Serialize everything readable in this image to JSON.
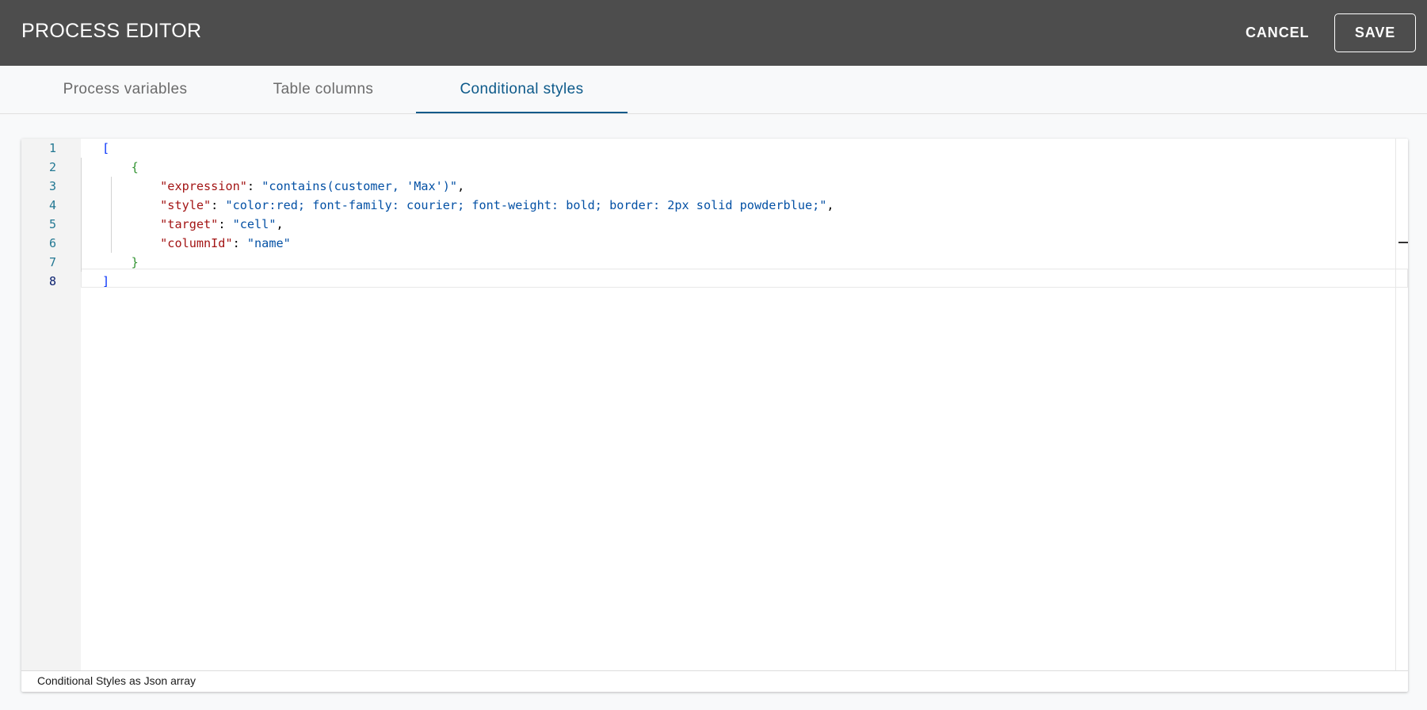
{
  "header": {
    "title": "PROCESS EDITOR",
    "cancel_label": "CANCEL",
    "save_label": "SAVE"
  },
  "tabs": [
    {
      "label": "Process variables",
      "active": false
    },
    {
      "label": "Table columns",
      "active": false
    },
    {
      "label": "Conditional styles",
      "active": true
    }
  ],
  "editor": {
    "line_numbers": [
      "1",
      "2",
      "3",
      "4",
      "5",
      "6",
      "7",
      "8"
    ],
    "current_line": "8",
    "lines": [
      {
        "indent": "",
        "tokens": [
          {
            "t": "b1",
            "v": "["
          }
        ]
      },
      {
        "indent": "    ",
        "tokens": [
          {
            "t": "b2",
            "v": "{"
          }
        ]
      },
      {
        "indent": "        ",
        "tokens": [
          {
            "t": "k",
            "v": "\"expression\""
          },
          {
            "t": "p",
            "v": ": "
          },
          {
            "t": "s",
            "v": "\"contains(customer, 'Max')\""
          },
          {
            "t": "p",
            "v": ","
          }
        ]
      },
      {
        "indent": "        ",
        "tokens": [
          {
            "t": "k",
            "v": "\"style\""
          },
          {
            "t": "p",
            "v": ": "
          },
          {
            "t": "s",
            "v": "\"color:red; font-family: courier; font-weight: bold; border: 2px solid powderblue;\""
          },
          {
            "t": "p",
            "v": ","
          }
        ]
      },
      {
        "indent": "        ",
        "tokens": [
          {
            "t": "k",
            "v": "\"target\""
          },
          {
            "t": "p",
            "v": ": "
          },
          {
            "t": "s",
            "v": "\"cell\""
          },
          {
            "t": "p",
            "v": ","
          }
        ]
      },
      {
        "indent": "        ",
        "tokens": [
          {
            "t": "k",
            "v": "\"columnId\""
          },
          {
            "t": "p",
            "v": ": "
          },
          {
            "t": "s",
            "v": "\"name\""
          }
        ]
      },
      {
        "indent": "    ",
        "tokens": [
          {
            "t": "b2",
            "v": "}"
          }
        ]
      },
      {
        "indent": "",
        "tokens": [
          {
            "t": "b1",
            "v": "]"
          }
        ]
      }
    ]
  },
  "footer": {
    "hint": "Conditional Styles as Json array"
  },
  "colors": {
    "header_bg": "#4d4d4d",
    "active_tab": "#0d5a8a",
    "key": "#a31515",
    "string": "#0451a5"
  }
}
